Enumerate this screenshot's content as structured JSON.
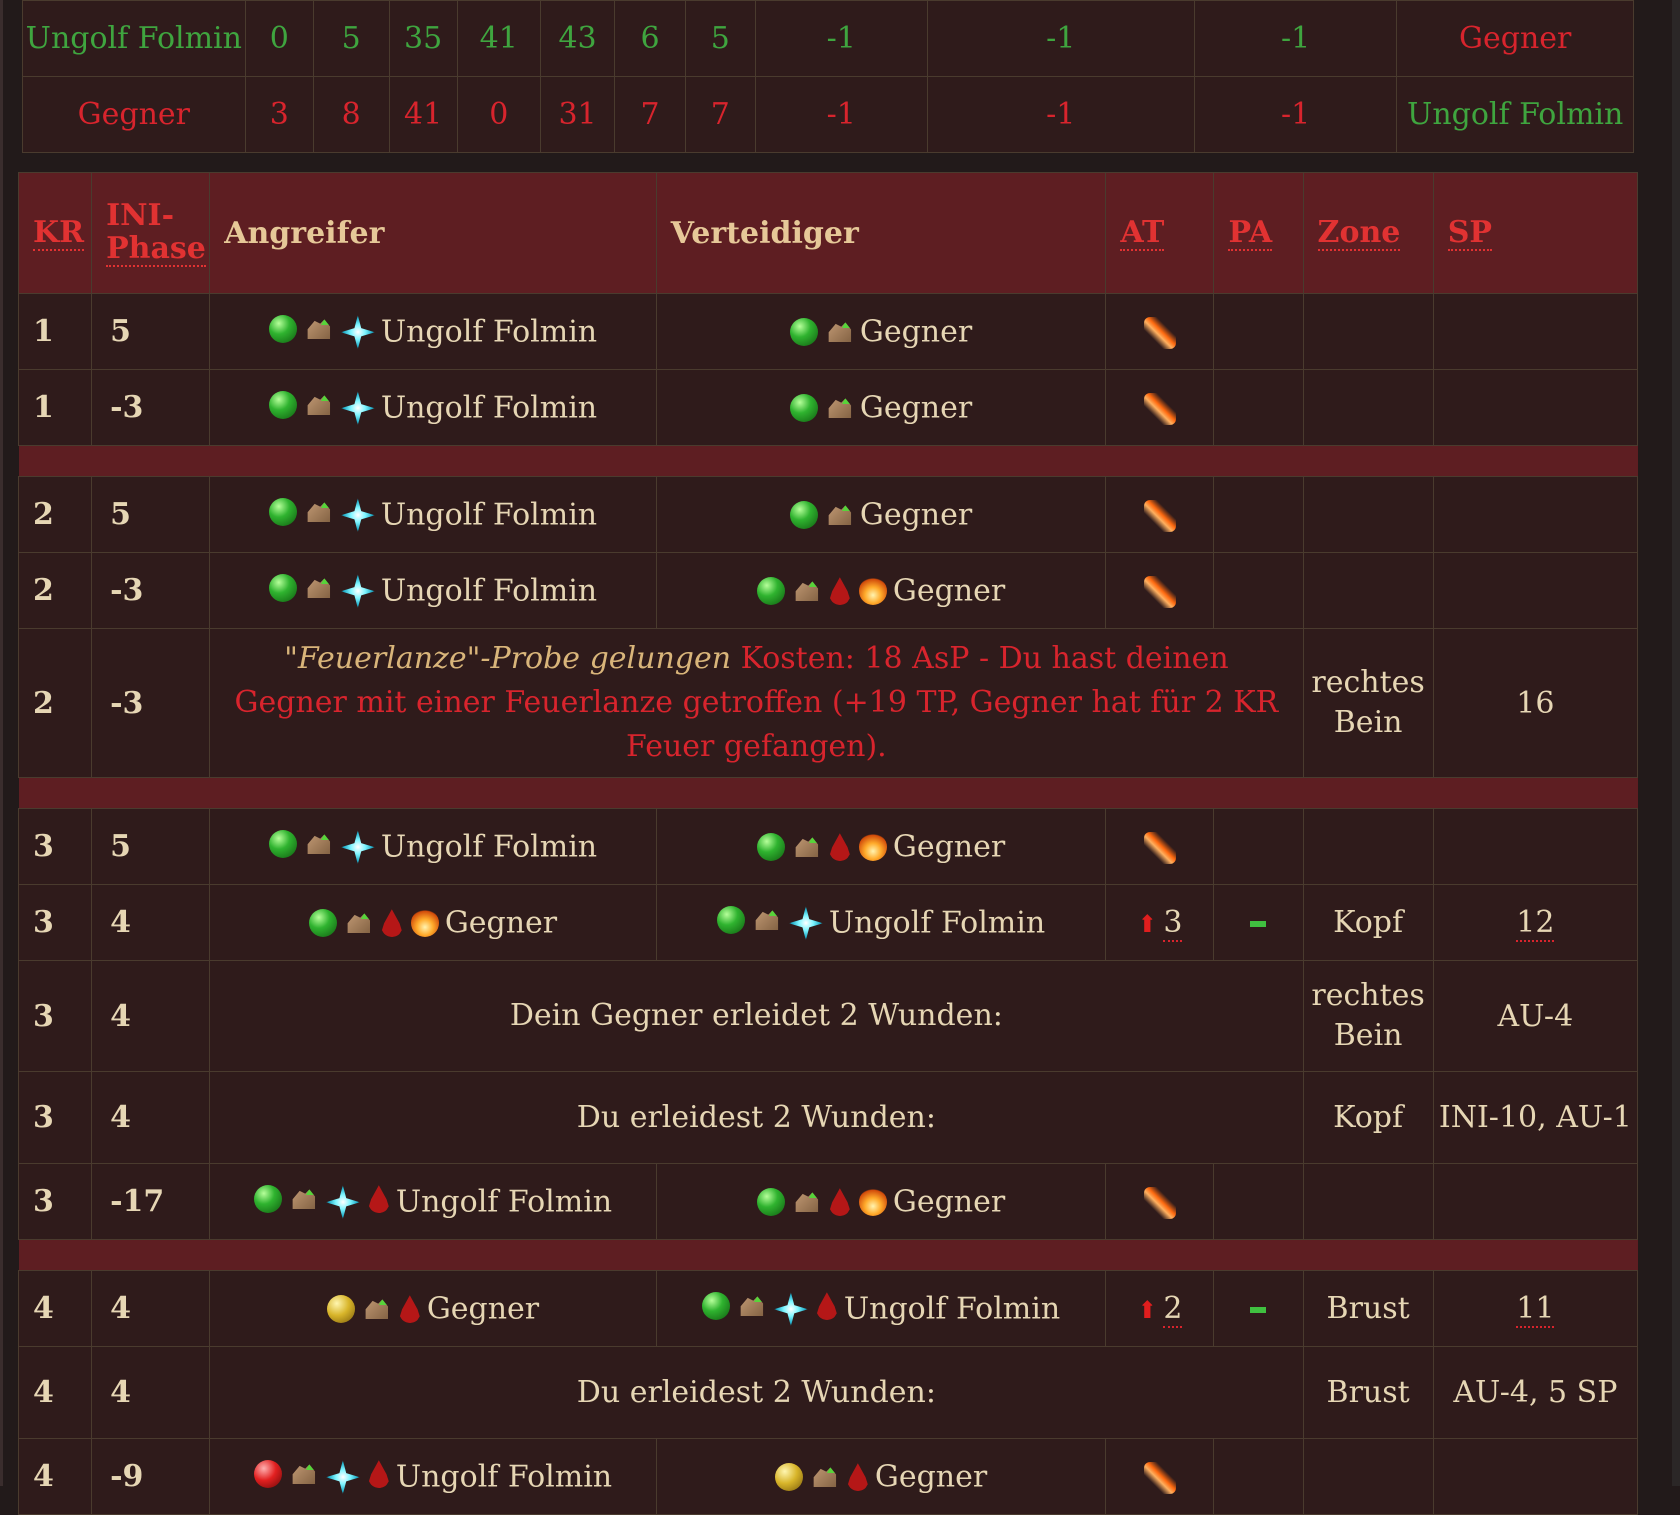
{
  "stats": {
    "rows": [
      {
        "name": "Ungolf Folmin",
        "vals": [
          "0",
          "5",
          "35",
          "41",
          "43",
          "6",
          "5",
          "-1",
          "-1",
          "-1"
        ],
        "opponent": "Gegner"
      },
      {
        "name": "Gegner",
        "vals": [
          "3",
          "8",
          "41",
          "0",
          "31",
          "7",
          "7",
          "-1",
          "-1",
          "-1"
        ],
        "opponent": "Ungolf Folmin"
      }
    ]
  },
  "log": {
    "headers": {
      "kr": "KR",
      "ini_1": "INI-",
      "ini_2": "Phase",
      "attacker": "Angreifer",
      "defender": "Verteidiger",
      "at": "AT",
      "pa": "PA",
      "zone": "Zone",
      "sp": "SP"
    },
    "rows": [
      {
        "kr": "1",
        "ini": "5",
        "attacker": "Ungolf Folmin",
        "defender": "Gegner"
      },
      {
        "kr": "1",
        "ini": "-3",
        "attacker": "Ungolf Folmin",
        "defender": "Gegner"
      },
      {
        "kr": "2",
        "ini": "5",
        "attacker": "Ungolf Folmin",
        "defender": "Gegner"
      },
      {
        "kr": "2",
        "ini": "-3",
        "attacker": "Ungolf Folmin",
        "defender": "Gegner"
      },
      {
        "kr": "2",
        "ini": "-3",
        "msg_italic": "\"Feuerlanze\"-Probe gelungen",
        "msg": " Kosten: 18 AsP - Du hast deinen Gegner mit einer Feuerlanze getroffen (+19 TP, Gegner hat für 2 KR Feuer gefangen).",
        "zone_1": "rechtes",
        "zone_2": "Bein",
        "sp": "16"
      },
      {
        "kr": "3",
        "ini": "5",
        "attacker": "Ungolf Folmin",
        "defender": "Gegner"
      },
      {
        "kr": "3",
        "ini": "4",
        "attacker": "Gegner",
        "defender": "Ungolf Folmin",
        "at": "3",
        "zone": "Kopf",
        "sp": "12"
      },
      {
        "kr": "3",
        "ini": "4",
        "msg": "Dein Gegner erleidet 2 Wunden:",
        "zone_1": "rechtes",
        "zone_2": "Bein",
        "sp": "AU-4"
      },
      {
        "kr": "3",
        "ini": "4",
        "msg": "Du erleidest 2 Wunden:",
        "zone": "Kopf",
        "sp": "INI-10, AU-1"
      },
      {
        "kr": "3",
        "ini": "-17",
        "attacker": "Ungolf Folmin",
        "defender": "Gegner"
      },
      {
        "kr": "4",
        "ini": "4",
        "attacker": "Gegner",
        "defender": "Ungolf Folmin",
        "at": "2",
        "zone": "Brust",
        "sp": "11"
      },
      {
        "kr": "4",
        "ini": "4",
        "msg": "Du erleidest 2 Wunden:",
        "zone": "Brust",
        "sp": "AU-4, 5 SP"
      },
      {
        "kr": "4",
        "ini": "-9",
        "attacker": "Ungolf Folmin",
        "defender": "Gegner"
      }
    ]
  },
  "colors": {
    "friend": "#3fa53f",
    "enemy": "#d8242d",
    "header_bg": "#5e1e22",
    "text": "#e6d6b4"
  }
}
